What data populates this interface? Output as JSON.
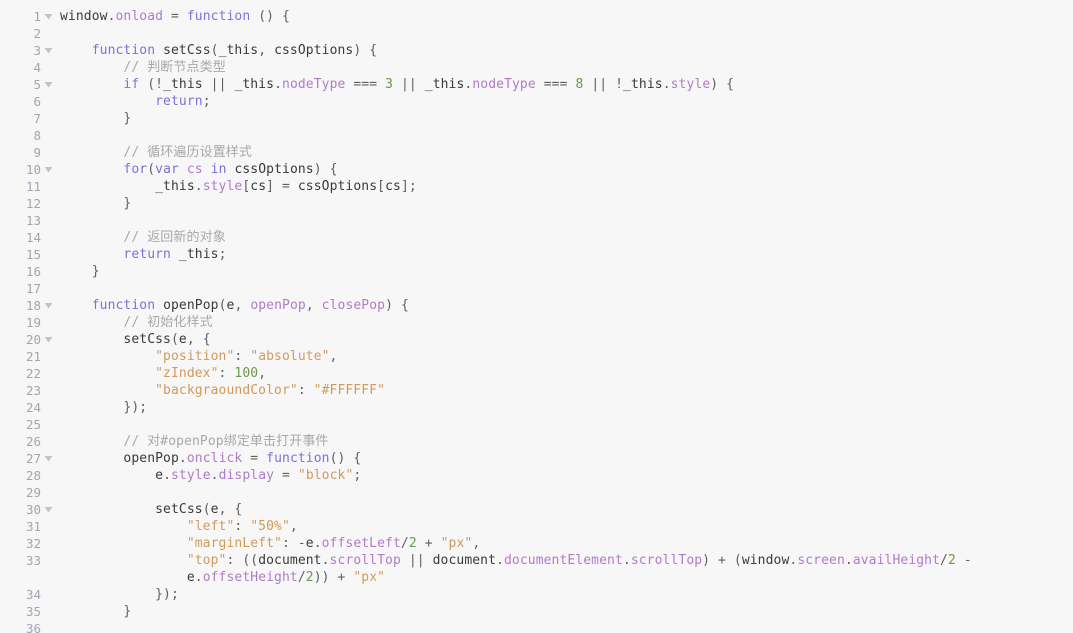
{
  "editor": {
    "language": "JavaScript",
    "background_color": "#f7f7f7",
    "gutter_color": "#f7f7f7",
    "line_number_color": "#a3a6b2",
    "fold_arrow_color": "#c3c3cc",
    "font_size_px": 13,
    "line_height_px": 17,
    "first_visible_line": 1,
    "last_visible_line": 36,
    "total_visible_rows": 37
  },
  "syntax_colors": {
    "keyword": "#7d72d6",
    "property": "#b07bc9",
    "identifier": "#3a3a3a",
    "string": "#d19a5c",
    "number": "#6a9a4a",
    "comment": "#a8a8a8",
    "punctuation": "#5f5f5f",
    "operator": "#5f5f5f"
  },
  "lines": [
    {
      "number": 1,
      "fold": "open",
      "tokens": [
        {
          "t": "window",
          "c": "t-id"
        },
        {
          "t": ".",
          "c": "t-punc"
        },
        {
          "t": "onload",
          "c": "t-prop"
        },
        {
          "t": " ",
          "c": "t-punc"
        },
        {
          "t": "=",
          "c": "t-op"
        },
        {
          "t": " ",
          "c": "t-punc"
        },
        {
          "t": "function",
          "c": "t-kw"
        },
        {
          "t": " () {",
          "c": "t-punc"
        }
      ],
      "text": "window.onload = function () {"
    },
    {
      "number": 2,
      "fold": "none",
      "tokens": [],
      "text": ""
    },
    {
      "number": 3,
      "fold": "open",
      "tokens": [
        {
          "t": "    ",
          "c": "t-punc"
        },
        {
          "t": "function",
          "c": "t-kw"
        },
        {
          "t": " ",
          "c": "t-punc"
        },
        {
          "t": "setCss",
          "c": "t-id"
        },
        {
          "t": "(",
          "c": "t-punc"
        },
        {
          "t": "_this",
          "c": "t-id"
        },
        {
          "t": ", ",
          "c": "t-punc"
        },
        {
          "t": "cssOptions",
          "c": "t-id"
        },
        {
          "t": ") {",
          "c": "t-punc"
        }
      ],
      "text": "    function setCss(_this, cssOptions) {"
    },
    {
      "number": 4,
      "fold": "none",
      "tokens": [
        {
          "t": "        ",
          "c": "t-punc"
        },
        {
          "t": "// 判断节点类型",
          "c": "t-com"
        }
      ],
      "text": "        // 判断节点类型"
    },
    {
      "number": 5,
      "fold": "open",
      "tokens": [
        {
          "t": "        ",
          "c": "t-punc"
        },
        {
          "t": "if",
          "c": "t-kw"
        },
        {
          "t": " (",
          "c": "t-punc"
        },
        {
          "t": "!",
          "c": "t-op"
        },
        {
          "t": "_this",
          "c": "t-id"
        },
        {
          "t": " ",
          "c": "t-punc"
        },
        {
          "t": "||",
          "c": "t-op"
        },
        {
          "t": " ",
          "c": "t-punc"
        },
        {
          "t": "_this",
          "c": "t-id"
        },
        {
          "t": ".",
          "c": "t-punc"
        },
        {
          "t": "nodeType",
          "c": "t-prop"
        },
        {
          "t": " ",
          "c": "t-punc"
        },
        {
          "t": "===",
          "c": "t-op"
        },
        {
          "t": " ",
          "c": "t-punc"
        },
        {
          "t": "3",
          "c": "t-num"
        },
        {
          "t": " ",
          "c": "t-punc"
        },
        {
          "t": "||",
          "c": "t-op"
        },
        {
          "t": " ",
          "c": "t-punc"
        },
        {
          "t": "_this",
          "c": "t-id"
        },
        {
          "t": ".",
          "c": "t-punc"
        },
        {
          "t": "nodeType",
          "c": "t-prop"
        },
        {
          "t": " ",
          "c": "t-punc"
        },
        {
          "t": "===",
          "c": "t-op"
        },
        {
          "t": " ",
          "c": "t-punc"
        },
        {
          "t": "8",
          "c": "t-num"
        },
        {
          "t": " ",
          "c": "t-punc"
        },
        {
          "t": "||",
          "c": "t-op"
        },
        {
          "t": " ",
          "c": "t-punc"
        },
        {
          "t": "!",
          "c": "t-op"
        },
        {
          "t": "_this",
          "c": "t-id"
        },
        {
          "t": ".",
          "c": "t-punc"
        },
        {
          "t": "style",
          "c": "t-prop"
        },
        {
          "t": ") {",
          "c": "t-punc"
        }
      ],
      "text": "        if (!_this || _this.nodeType === 3 || _this.nodeType === 8 || !_this.style) {"
    },
    {
      "number": 6,
      "fold": "none",
      "tokens": [
        {
          "t": "            ",
          "c": "t-punc"
        },
        {
          "t": "return",
          "c": "t-kw"
        },
        {
          "t": ";",
          "c": "t-punc"
        }
      ],
      "text": "            return;"
    },
    {
      "number": 7,
      "fold": "none",
      "tokens": [
        {
          "t": "        }",
          "c": "t-punc"
        }
      ],
      "text": "        }"
    },
    {
      "number": 8,
      "fold": "none",
      "tokens": [],
      "text": ""
    },
    {
      "number": 9,
      "fold": "none",
      "tokens": [
        {
          "t": "        ",
          "c": "t-punc"
        },
        {
          "t": "// 循环遍历设置样式",
          "c": "t-com"
        }
      ],
      "text": "        // 循环遍历设置样式"
    },
    {
      "number": 10,
      "fold": "open",
      "tokens": [
        {
          "t": "        ",
          "c": "t-punc"
        },
        {
          "t": "for",
          "c": "t-kw"
        },
        {
          "t": "(",
          "c": "t-punc"
        },
        {
          "t": "var",
          "c": "t-kw"
        },
        {
          "t": " ",
          "c": "t-punc"
        },
        {
          "t": "cs",
          "c": "t-prop"
        },
        {
          "t": " ",
          "c": "t-punc"
        },
        {
          "t": "in",
          "c": "t-kw"
        },
        {
          "t": " ",
          "c": "t-punc"
        },
        {
          "t": "cssOptions",
          "c": "t-id"
        },
        {
          "t": ") {",
          "c": "t-punc"
        }
      ],
      "text": "        for(var cs in cssOptions) {"
    },
    {
      "number": 11,
      "fold": "none",
      "tokens": [
        {
          "t": "            ",
          "c": "t-punc"
        },
        {
          "t": "_this",
          "c": "t-id"
        },
        {
          "t": ".",
          "c": "t-punc"
        },
        {
          "t": "style",
          "c": "t-prop"
        },
        {
          "t": "[",
          "c": "t-punc"
        },
        {
          "t": "cs",
          "c": "t-id"
        },
        {
          "t": "] ",
          "c": "t-punc"
        },
        {
          "t": "=",
          "c": "t-op"
        },
        {
          "t": " ",
          "c": "t-punc"
        },
        {
          "t": "cssOptions",
          "c": "t-id"
        },
        {
          "t": "[",
          "c": "t-punc"
        },
        {
          "t": "cs",
          "c": "t-id"
        },
        {
          "t": "];",
          "c": "t-punc"
        }
      ],
      "text": "            _this.style[cs] = cssOptions[cs];"
    },
    {
      "number": 12,
      "fold": "none",
      "tokens": [
        {
          "t": "        }",
          "c": "t-punc"
        }
      ],
      "text": "        }"
    },
    {
      "number": 13,
      "fold": "none",
      "tokens": [],
      "text": ""
    },
    {
      "number": 14,
      "fold": "none",
      "tokens": [
        {
          "t": "        ",
          "c": "t-punc"
        },
        {
          "t": "// 返回新的对象",
          "c": "t-com"
        }
      ],
      "text": "        // 返回新的对象"
    },
    {
      "number": 15,
      "fold": "none",
      "tokens": [
        {
          "t": "        ",
          "c": "t-punc"
        },
        {
          "t": "return",
          "c": "t-kw"
        },
        {
          "t": " ",
          "c": "t-punc"
        },
        {
          "t": "_this",
          "c": "t-id"
        },
        {
          "t": ";",
          "c": "t-punc"
        }
      ],
      "text": "        return _this;"
    },
    {
      "number": 16,
      "fold": "none",
      "tokens": [
        {
          "t": "    }",
          "c": "t-punc"
        }
      ],
      "text": "    }"
    },
    {
      "number": 17,
      "fold": "none",
      "tokens": [],
      "text": ""
    },
    {
      "number": 18,
      "fold": "open",
      "tokens": [
        {
          "t": "    ",
          "c": "t-punc"
        },
        {
          "t": "function",
          "c": "t-kw"
        },
        {
          "t": " ",
          "c": "t-punc"
        },
        {
          "t": "openPop",
          "c": "t-id"
        },
        {
          "t": "(",
          "c": "t-punc"
        },
        {
          "t": "e",
          "c": "t-id"
        },
        {
          "t": ", ",
          "c": "t-punc"
        },
        {
          "t": "openPop",
          "c": "t-prop"
        },
        {
          "t": ", ",
          "c": "t-punc"
        },
        {
          "t": "closePop",
          "c": "t-prop"
        },
        {
          "t": ") {",
          "c": "t-punc"
        }
      ],
      "text": "    function openPop(e, openPop, closePop) {"
    },
    {
      "number": 19,
      "fold": "none",
      "tokens": [
        {
          "t": "        ",
          "c": "t-punc"
        },
        {
          "t": "// 初始化样式",
          "c": "t-com"
        }
      ],
      "text": "        // 初始化样式"
    },
    {
      "number": 20,
      "fold": "open",
      "tokens": [
        {
          "t": "        ",
          "c": "t-punc"
        },
        {
          "t": "setCss",
          "c": "t-id"
        },
        {
          "t": "(",
          "c": "t-punc"
        },
        {
          "t": "e",
          "c": "t-id"
        },
        {
          "t": ", {",
          "c": "t-punc"
        }
      ],
      "text": "        setCss(e, {"
    },
    {
      "number": 21,
      "fold": "none",
      "tokens": [
        {
          "t": "            ",
          "c": "t-punc"
        },
        {
          "t": "\"position\"",
          "c": "t-str"
        },
        {
          "t": ": ",
          "c": "t-punc"
        },
        {
          "t": "\"absolute\"",
          "c": "t-str"
        },
        {
          "t": ",",
          "c": "t-punc"
        }
      ],
      "text": "            \"position\": \"absolute\","
    },
    {
      "number": 22,
      "fold": "none",
      "tokens": [
        {
          "t": "            ",
          "c": "t-punc"
        },
        {
          "t": "\"zIndex\"",
          "c": "t-str"
        },
        {
          "t": ": ",
          "c": "t-punc"
        },
        {
          "t": "100",
          "c": "t-num"
        },
        {
          "t": ",",
          "c": "t-punc"
        }
      ],
      "text": "            \"zIndex\": 100,"
    },
    {
      "number": 23,
      "fold": "none",
      "tokens": [
        {
          "t": "            ",
          "c": "t-punc"
        },
        {
          "t": "\"backgraoundColor\"",
          "c": "t-str"
        },
        {
          "t": ": ",
          "c": "t-punc"
        },
        {
          "t": "\"#FFFFFF\"",
          "c": "t-str"
        }
      ],
      "text": "            \"backgraoundColor\": \"#FFFFFF\""
    },
    {
      "number": 24,
      "fold": "none",
      "tokens": [
        {
          "t": "        });",
          "c": "t-punc"
        }
      ],
      "text": "        });"
    },
    {
      "number": 25,
      "fold": "none",
      "tokens": [],
      "text": ""
    },
    {
      "number": 26,
      "fold": "none",
      "tokens": [
        {
          "t": "        ",
          "c": "t-punc"
        },
        {
          "t": "// 对#openPop绑定单击打开事件",
          "c": "t-com"
        }
      ],
      "text": "        // 对#openPop绑定单击打开事件"
    },
    {
      "number": 27,
      "fold": "open",
      "tokens": [
        {
          "t": "        ",
          "c": "t-punc"
        },
        {
          "t": "openPop",
          "c": "t-id"
        },
        {
          "t": ".",
          "c": "t-punc"
        },
        {
          "t": "onclick",
          "c": "t-prop"
        },
        {
          "t": " ",
          "c": "t-punc"
        },
        {
          "t": "=",
          "c": "t-op"
        },
        {
          "t": " ",
          "c": "t-punc"
        },
        {
          "t": "function",
          "c": "t-kw"
        },
        {
          "t": "() {",
          "c": "t-punc"
        }
      ],
      "text": "        openPop.onclick = function() {"
    },
    {
      "number": 28,
      "fold": "none",
      "tokens": [
        {
          "t": "            ",
          "c": "t-punc"
        },
        {
          "t": "e",
          "c": "t-id"
        },
        {
          "t": ".",
          "c": "t-punc"
        },
        {
          "t": "style",
          "c": "t-prop"
        },
        {
          "t": ".",
          "c": "t-punc"
        },
        {
          "t": "display",
          "c": "t-prop"
        },
        {
          "t": " ",
          "c": "t-punc"
        },
        {
          "t": "=",
          "c": "t-op"
        },
        {
          "t": " ",
          "c": "t-punc"
        },
        {
          "t": "\"block\"",
          "c": "t-str"
        },
        {
          "t": ";",
          "c": "t-punc"
        }
      ],
      "text": "            e.style.display = \"block\";"
    },
    {
      "number": 29,
      "fold": "none",
      "tokens": [],
      "text": ""
    },
    {
      "number": 30,
      "fold": "open",
      "tokens": [
        {
          "t": "            ",
          "c": "t-punc"
        },
        {
          "t": "setCss",
          "c": "t-id"
        },
        {
          "t": "(",
          "c": "t-punc"
        },
        {
          "t": "e",
          "c": "t-id"
        },
        {
          "t": ", {",
          "c": "t-punc"
        }
      ],
      "text": "            setCss(e, {"
    },
    {
      "number": 31,
      "fold": "none",
      "tokens": [
        {
          "t": "                ",
          "c": "t-punc"
        },
        {
          "t": "\"left\"",
          "c": "t-str"
        },
        {
          "t": ": ",
          "c": "t-punc"
        },
        {
          "t": "\"50%\"",
          "c": "t-str"
        },
        {
          "t": ",",
          "c": "t-punc"
        }
      ],
      "text": "                \"left\": \"50%\","
    },
    {
      "number": 32,
      "fold": "none",
      "tokens": [
        {
          "t": "                ",
          "c": "t-punc"
        },
        {
          "t": "\"marginLeft\"",
          "c": "t-str"
        },
        {
          "t": ": ",
          "c": "t-punc"
        },
        {
          "t": "-",
          "c": "t-op"
        },
        {
          "t": "e",
          "c": "t-id"
        },
        {
          "t": ".",
          "c": "t-punc"
        },
        {
          "t": "offsetLeft",
          "c": "t-prop"
        },
        {
          "t": "/",
          "c": "t-op"
        },
        {
          "t": "2",
          "c": "t-num"
        },
        {
          "t": " ",
          "c": "t-punc"
        },
        {
          "t": "+",
          "c": "t-op"
        },
        {
          "t": " ",
          "c": "t-punc"
        },
        {
          "t": "\"px\"",
          "c": "t-str"
        },
        {
          "t": ",",
          "c": "t-punc"
        }
      ],
      "text": "                \"marginLeft\": -e.offsetLeft/2 + \"px\","
    },
    {
      "number": 33,
      "fold": "none",
      "wrapped": true,
      "tokens": [
        {
          "t": "                ",
          "c": "t-punc"
        },
        {
          "t": "\"top\"",
          "c": "t-str"
        },
        {
          "t": ": ((",
          "c": "t-punc"
        },
        {
          "t": "document",
          "c": "t-id"
        },
        {
          "t": ".",
          "c": "t-punc"
        },
        {
          "t": "scrollTop",
          "c": "t-prop"
        },
        {
          "t": " ",
          "c": "t-punc"
        },
        {
          "t": "||",
          "c": "t-op"
        },
        {
          "t": " ",
          "c": "t-punc"
        },
        {
          "t": "document",
          "c": "t-id"
        },
        {
          "t": ".",
          "c": "t-punc"
        },
        {
          "t": "documentElement",
          "c": "t-prop"
        },
        {
          "t": ".",
          "c": "t-punc"
        },
        {
          "t": "scrollTop",
          "c": "t-prop"
        },
        {
          "t": ") ",
          "c": "t-punc"
        },
        {
          "t": "+",
          "c": "t-op"
        },
        {
          "t": " (",
          "c": "t-punc"
        },
        {
          "t": "window",
          "c": "t-id"
        },
        {
          "t": ".",
          "c": "t-punc"
        },
        {
          "t": "screen",
          "c": "t-prop"
        },
        {
          "t": ".",
          "c": "t-punc"
        },
        {
          "t": "availHeight",
          "c": "t-prop"
        },
        {
          "t": "/",
          "c": "t-op"
        },
        {
          "t": "2",
          "c": "t-num"
        },
        {
          "t": " ",
          "c": "t-punc"
        },
        {
          "t": "-",
          "c": "t-op"
        }
      ],
      "text": "                \"top\": ((document.scrollTop || document.documentElement.scrollTop) + (window.screen.availHeight/2 -"
    },
    {
      "number": null,
      "fold": "none",
      "continuation": true,
      "tokens": [
        {
          "t": "                ",
          "c": "t-punc"
        },
        {
          "t": "e",
          "c": "t-id"
        },
        {
          "t": ".",
          "c": "t-punc"
        },
        {
          "t": "offsetHeight",
          "c": "t-prop"
        },
        {
          "t": "/",
          "c": "t-op"
        },
        {
          "t": "2",
          "c": "t-num"
        },
        {
          "t": ")) ",
          "c": "t-punc"
        },
        {
          "t": "+",
          "c": "t-op"
        },
        {
          "t": " ",
          "c": "t-punc"
        },
        {
          "t": "\"px\"",
          "c": "t-str"
        }
      ],
      "text": "                e.offsetHeight/2)) + \"px\""
    },
    {
      "number": 34,
      "fold": "none",
      "tokens": [
        {
          "t": "            });",
          "c": "t-punc"
        }
      ],
      "text": "            });"
    },
    {
      "number": 35,
      "fold": "none",
      "tokens": [
        {
          "t": "        }",
          "c": "t-punc"
        }
      ],
      "text": "        }"
    },
    {
      "number": 36,
      "fold": "none",
      "tokens": [],
      "text": ""
    }
  ]
}
